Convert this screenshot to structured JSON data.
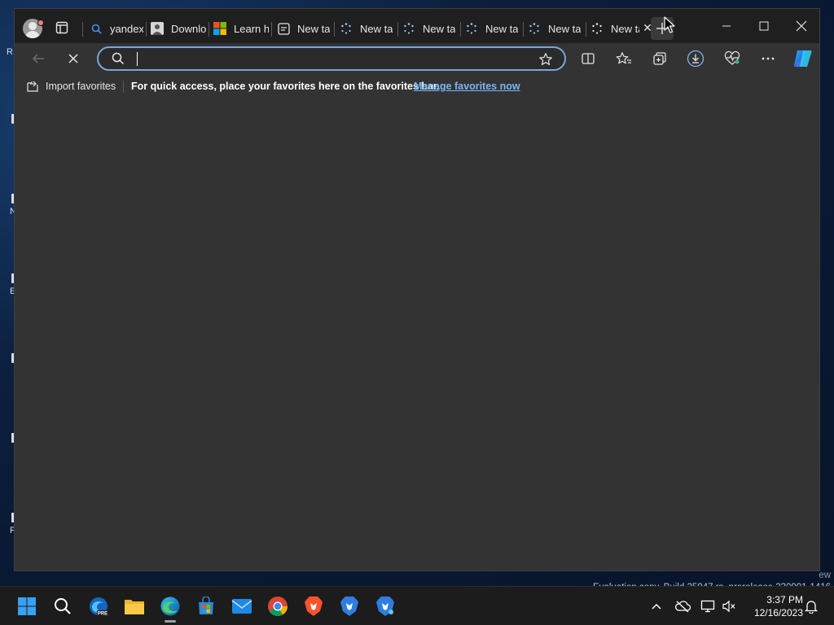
{
  "desktop": {
    "fragments": [
      "R",
      "N",
      "E",
      "I",
      "C",
      "M",
      "F"
    ],
    "watermark": {
      "line1": "ew",
      "line2": "Evaluation copy. Build 25947.rs_prerelease.230901-1416"
    }
  },
  "browser": {
    "tabs": [
      {
        "title": "yandex",
        "icon": "search-icon"
      },
      {
        "title": "Downlo",
        "icon": "profile-picture-icon"
      },
      {
        "title": "Learn h",
        "icon": "microsoft-logo-icon"
      },
      {
        "title": "New ta",
        "icon": "newtab-page-icon"
      },
      {
        "title": "New ta",
        "icon": "loading-spinner-icon"
      },
      {
        "title": "New ta",
        "icon": "loading-spinner-icon"
      },
      {
        "title": "New ta",
        "icon": "loading-spinner-icon"
      },
      {
        "title": "New ta",
        "icon": "loading-spinner-icon"
      },
      {
        "title": "New ta",
        "icon": "loading-spinner-icon",
        "active": true
      }
    ],
    "address_bar": {
      "value": "",
      "placeholder": ""
    },
    "favorites_bar": {
      "import_label": "Import favorites",
      "message": "For quick access, place your favorites here on the favorites bar.",
      "manage_link": "Manage favorites now"
    },
    "colors": {
      "accent": "#7ab7f5",
      "focus_ring": "#7aa7d9",
      "background": "#333333"
    }
  },
  "taskbar": {
    "apps": [
      "start-icon",
      "search-icon",
      "edge-beta-icon",
      "file-explorer-icon",
      "edge-icon",
      "microsoft-store-icon",
      "mail-icon",
      "chrome-icon",
      "brave-icon",
      "brave-beta-icon",
      "brave-nightly-icon"
    ],
    "clock": {
      "time": "3:37 PM",
      "date": "12/16/2023"
    }
  }
}
